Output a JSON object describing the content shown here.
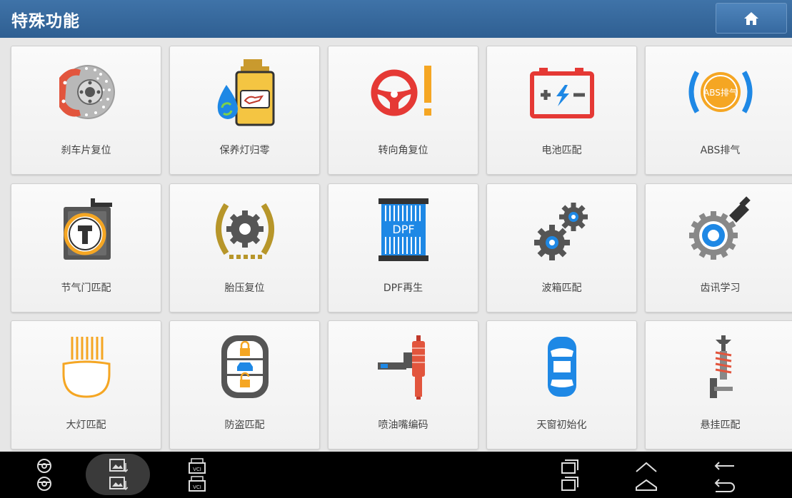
{
  "header": {
    "title": "特殊功能",
    "home_icon": "home-icon"
  },
  "tiles": [
    {
      "label": "刹车片复位",
      "icon": "brake-disc-icon"
    },
    {
      "label": "保养灯归零",
      "icon": "oil-reset-icon"
    },
    {
      "label": "转向角复位",
      "icon": "steering-warning-icon"
    },
    {
      "label": "电池匹配",
      "icon": "battery-icon"
    },
    {
      "label": "ABS排气",
      "icon": "abs-icon",
      "badge": "ABS排气"
    },
    {
      "label": "节气门匹配",
      "icon": "throttle-icon"
    },
    {
      "label": "胎压复位",
      "icon": "tire-pressure-icon"
    },
    {
      "label": "DPF再生",
      "icon": "dpf-icon",
      "badge": "DPF"
    },
    {
      "label": "波箱匹配",
      "icon": "gears-icon"
    },
    {
      "label": "齿讯学习",
      "icon": "tooth-signal-icon"
    },
    {
      "label": "大灯匹配",
      "icon": "headlight-icon"
    },
    {
      "label": "防盗匹配",
      "icon": "immobilizer-icon"
    },
    {
      "label": "喷油嘴编码",
      "icon": "injector-icon"
    },
    {
      "label": "天窗初始化",
      "icon": "sunroof-icon"
    },
    {
      "label": "悬挂匹配",
      "icon": "suspension-icon"
    }
  ],
  "navbar": {
    "items": [
      {
        "icon": "steering-wheel-icon"
      },
      {
        "icon": "screenshot-icon"
      },
      {
        "icon": "vci-icon",
        "text": "VCI"
      },
      {
        "icon": "recent-apps-icon"
      },
      {
        "icon": "home-nav-icon"
      },
      {
        "icon": "back-icon"
      }
    ]
  },
  "colors": {
    "header": "#3a6ea5",
    "accent_orange": "#f5a623",
    "accent_blue": "#1e88e5",
    "accent_red": "#e53935"
  }
}
